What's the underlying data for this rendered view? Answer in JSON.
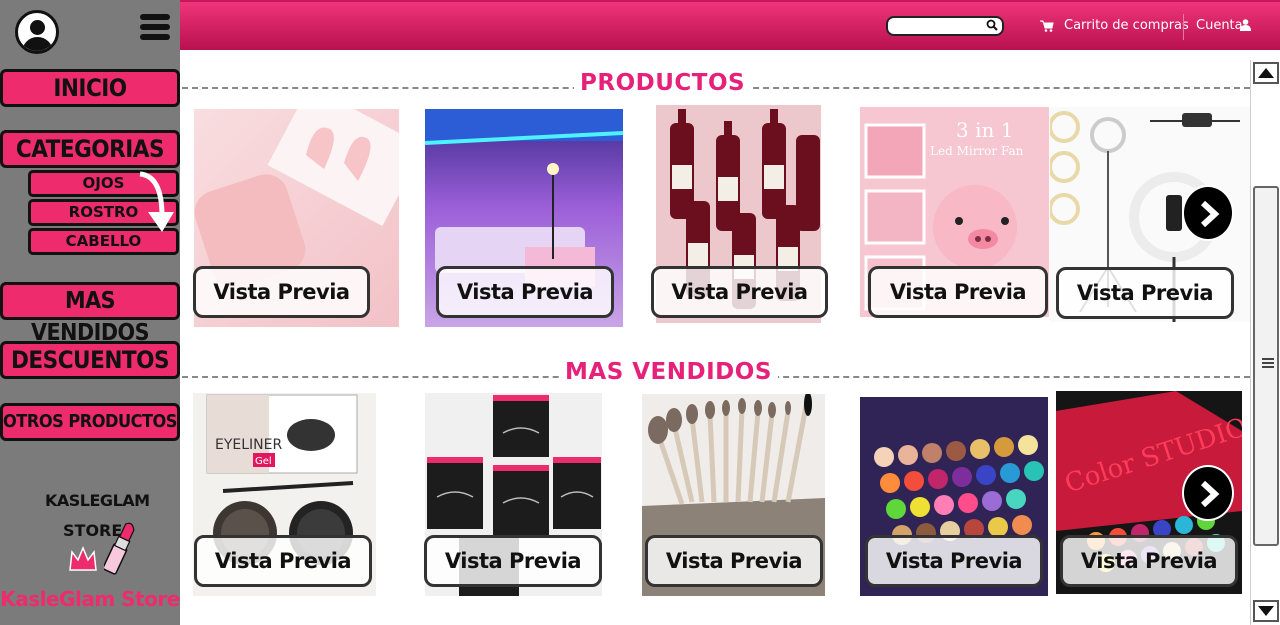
{
  "sidebar": {
    "nav": {
      "inicio": "INICIO",
      "categorias": "CATEGORIAS",
      "mas_vendidos": "MAS VENDIDOS",
      "descuentos": "DESCUENTOS",
      "otros_productos": "OTROS PRODUCTOS"
    },
    "sub_categories": [
      "OJOS",
      "ROSTRO",
      "CABELLO"
    ],
    "logo": {
      "line1": "KASLEGLAM",
      "line2": "STORE"
    },
    "store_name": "KasleGlam Store"
  },
  "header": {
    "search_placeholder": "",
    "cart_label": "Carrito de compras",
    "account_label": "Cuenta"
  },
  "sections": {
    "productos": {
      "title": "PRODUCTOS",
      "items": [
        {
          "name": "pink-earbuds",
          "button": "Vista Previa"
        },
        {
          "name": "led-room-lights",
          "button": "Vista Previa"
        },
        {
          "name": "wine-bottle-lipsticks",
          "button": "Vista Previa"
        },
        {
          "name": "mirror-fan-pig",
          "button": "Vista Previa",
          "image_text": "3 in 1",
          "image_text2": "Led Mirror Fan"
        },
        {
          "name": "ring-light",
          "button": "Vista Previa"
        }
      ]
    },
    "mas_vendidos": {
      "title": "MAS VENDIDOS",
      "items": [
        {
          "name": "eyeliner-gel",
          "button": "Vista Previa",
          "image_text": "EYELINER",
          "image_text2": "Gel"
        },
        {
          "name": "false-eyelashes",
          "button": "Vista Previa"
        },
        {
          "name": "brush-set",
          "button": "Vista Previa"
        },
        {
          "name": "eyeshadow-palette",
          "button": "Vista Previa"
        },
        {
          "name": "color-studio-palette",
          "button": "Vista Previa",
          "image_text": "Color STUDIO"
        }
      ]
    }
  },
  "colors": {
    "accent": "#ee2b6c",
    "topbar": "#d81b60",
    "sidebar": "#7b7b7b",
    "section_title": "#e5217a"
  }
}
